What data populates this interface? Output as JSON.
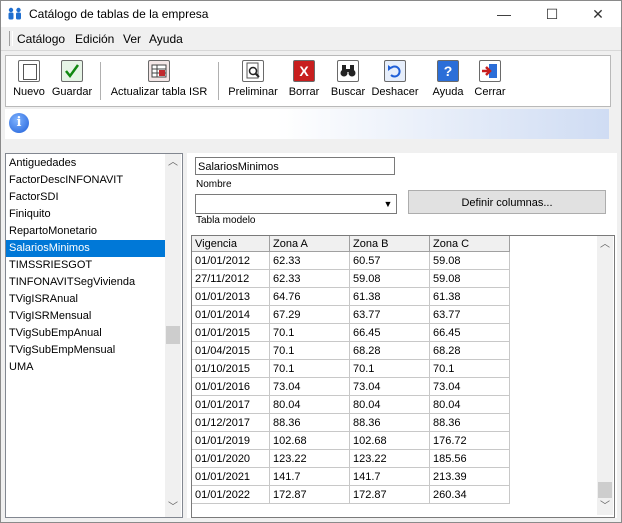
{
  "window": {
    "title": "Catálogo de tablas de la empresa",
    "minimize": "—",
    "maximize": "☐",
    "close": "✕"
  },
  "menu": [
    "Catálogo",
    "Edición",
    "Ver",
    "Ayuda"
  ],
  "toolbar": {
    "nuevo": "Nuevo",
    "guardar": "Guardar",
    "actualizar": "Actualizar tabla ISR",
    "preliminar": "Preliminar",
    "borrar": "Borrar",
    "buscar": "Buscar",
    "deshacer": "Deshacer",
    "ayuda": "Ayuda",
    "cerrar": "Cerrar"
  },
  "info": {
    "icon": "i"
  },
  "tables": [
    "Antiguedades",
    "FactorDescINFONAVIT",
    "FactorSDI",
    "Finiquito",
    "RepartoMonetario",
    "SalariosMinimos",
    "TIMSSRIESGOT",
    "TINFONAVITSegVivienda",
    "TVigISRAnual",
    "TVigISRMensual",
    "TVigSubEmpAnual",
    "TVigSubEmpMensual",
    "UMA"
  ],
  "selected_index": 5,
  "form": {
    "nombre_value": "SalariosMinimos",
    "nombre_label": "Nombre",
    "tabla_modelo_value": "",
    "tabla_modelo_label": "Tabla modelo",
    "definir_button": "Definir columnas..."
  },
  "grid": {
    "headers": [
      "Vigencia",
      "Zona  A",
      "Zona  B",
      "Zona  C"
    ],
    "rows": [
      [
        "01/01/2012",
        "62.33",
        "60.57",
        "59.08"
      ],
      [
        "27/11/2012",
        "62.33",
        "59.08",
        "59.08"
      ],
      [
        "01/01/2013",
        "64.76",
        "61.38",
        "61.38"
      ],
      [
        "01/01/2014",
        "67.29",
        "63.77",
        "63.77"
      ],
      [
        "01/01/2015",
        "70.1",
        "66.45",
        "66.45"
      ],
      [
        "01/04/2015",
        "70.1",
        "68.28",
        "68.28"
      ],
      [
        "01/10/2015",
        "70.1",
        "70.1",
        "70.1"
      ],
      [
        "01/01/2016",
        "73.04",
        "73.04",
        "73.04"
      ],
      [
        "01/01/2017",
        "80.04",
        "80.04",
        "80.04"
      ],
      [
        "01/12/2017",
        "88.36",
        "88.36",
        "88.36"
      ],
      [
        "01/01/2019",
        "102.68",
        "102.68",
        "176.72"
      ],
      [
        "01/01/2020",
        "123.22",
        "123.22",
        "185.56"
      ],
      [
        "01/01/2021",
        "141.7",
        "141.7",
        "213.39"
      ],
      [
        "01/01/2022",
        "172.87",
        "172.87",
        "260.34"
      ]
    ]
  }
}
